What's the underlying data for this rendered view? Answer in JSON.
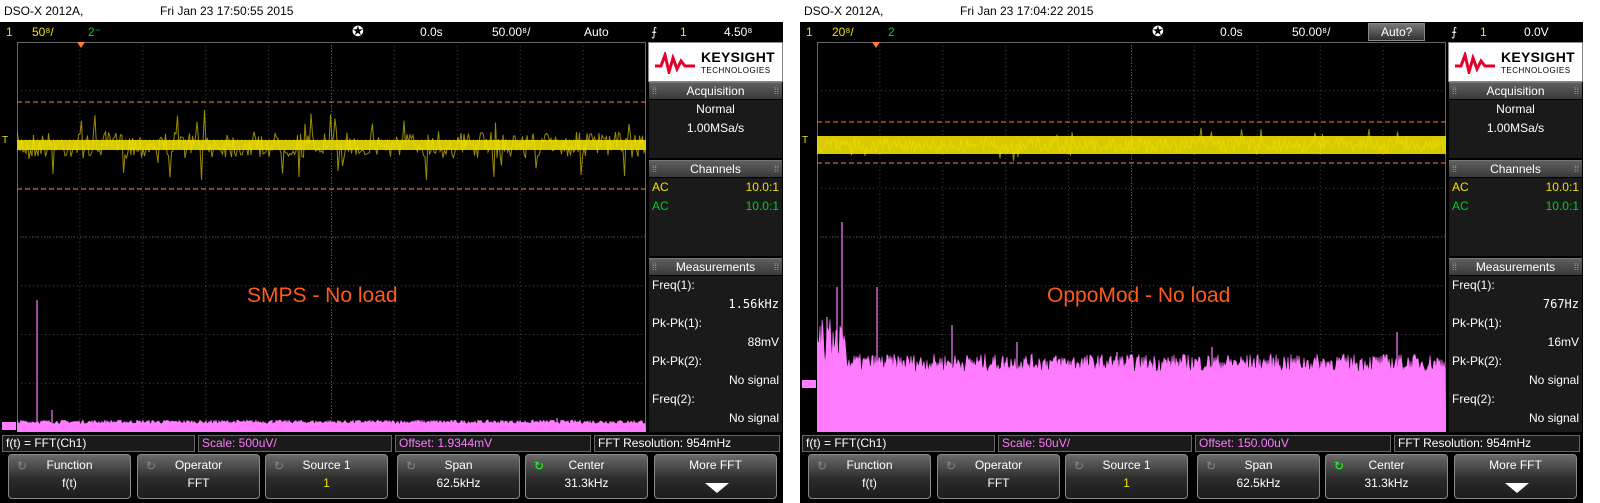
{
  "panels": [
    {
      "model": "DSO-X 2012A,",
      "datetime": "Fri Jan 23 17:50:55 2015",
      "top": {
        "ch1": "1",
        "ch1_scale": "50⁸/",
        "ch2": "2⁻",
        "time_offset": "0.0s",
        "time_scale": "50.00⁸/",
        "trigger_mode": "Auto",
        "trig_icon": "⨍",
        "trig_ch": "1",
        "trig_level": "4.50⁸"
      },
      "overlay_text": "SMPS - No load",
      "acq": {
        "title": "Acquisition",
        "mode": "Normal",
        "rate": "1.00MSa/s"
      },
      "channels": {
        "title": "Channels",
        "c1_coupling": "AC",
        "c1_probe": "10.0:1",
        "c2_coupling": "AC",
        "c2_probe": "10.0:1"
      },
      "meas": {
        "title": "Measurements",
        "m1_label": "Freq(1):",
        "m1_value": "1.56kHz",
        "m2_label": "Pk-Pk(1):",
        "m2_value": "88mV",
        "m3_label": "Pk-Pk(2):",
        "m3_value": "No signal",
        "m4_label": "Freq(2):",
        "m4_value": "No signal"
      },
      "line": {
        "func": "f(t) = FFT(Ch1)",
        "scale": "Scale: 500uV/",
        "offset": "Offset: 1.9344mV",
        "res": "FFT Resolution: 954mHz"
      },
      "buttons": [
        {
          "t": "Function",
          "v": "f(t)"
        },
        {
          "t": "Operator",
          "v": "FFT"
        },
        {
          "t": "Source 1",
          "v": "1"
        },
        {
          "t": "Span",
          "v": "62.5kHz"
        },
        {
          "t": "Center",
          "v": "31.3kHz"
        },
        {
          "t": "More FFT",
          "v": ""
        }
      ]
    },
    {
      "model": "DSO-X 2012A,",
      "datetime": "Fri Jan 23 17:04:22 2015",
      "top": {
        "ch1": "1",
        "ch1_scale": "20⁸/",
        "ch2": "2",
        "time_offset": "0.0s",
        "time_scale": "50.00⁸/",
        "trigger_mode": "Auto?",
        "trig_icon": "⨍",
        "trig_ch": "1",
        "trig_level": "0.0V"
      },
      "overlay_text": "OppoMod - No load",
      "acq": {
        "title": "Acquisition",
        "mode": "Normal",
        "rate": "1.00MSa/s"
      },
      "channels": {
        "title": "Channels",
        "c1_coupling": "AC",
        "c1_probe": "10.0:1",
        "c2_coupling": "AC",
        "c2_probe": "10.0:1"
      },
      "meas": {
        "title": "Measurements",
        "m1_label": "Freq(1):",
        "m1_value": "767Hz",
        "m2_label": "Pk-Pk(1):",
        "m2_value": "16mV",
        "m3_label": "Pk-Pk(2):",
        "m3_value": "No signal",
        "m4_label": "Freq(2):",
        "m4_value": "No signal"
      },
      "line": {
        "func": "f(t) = FFT(Ch1)",
        "scale": "Scale: 50uV/",
        "offset": "Offset: 150.00uV",
        "res": "FFT Resolution: 954mHz"
      },
      "buttons": [
        {
          "t": "Function",
          "v": "f(t)"
        },
        {
          "t": "Operator",
          "v": "FFT"
        },
        {
          "t": "Source 1",
          "v": "1"
        },
        {
          "t": "Span",
          "v": "62.5kHz"
        },
        {
          "t": "Center",
          "v": "31.3kHz"
        },
        {
          "t": "More FFT",
          "v": ""
        }
      ]
    }
  ],
  "logo": {
    "brand": "KEYSIGHT",
    "sub": "TECHNOLOGIES"
  },
  "colors": {
    "ch1": "#f0e000",
    "ch2": "#00d020",
    "math": "#ff7bff",
    "cursor": "#ff7a30",
    "overlay": "#ff5a1a"
  }
}
